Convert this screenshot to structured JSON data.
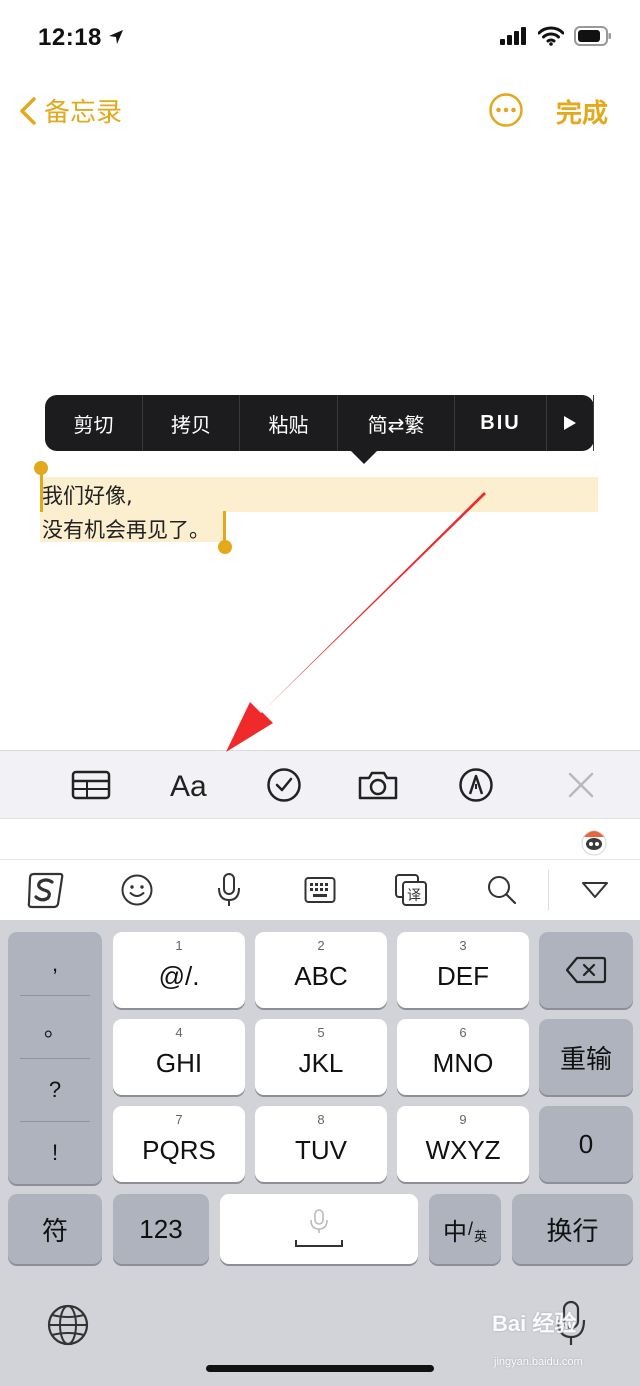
{
  "status_bar": {
    "time": "12:18"
  },
  "nav": {
    "back_label": "备忘录",
    "done_label": "完成"
  },
  "edit_menu": {
    "items": [
      "剪切",
      "拷贝",
      "粘贴",
      "简⇄繁",
      "BIU"
    ]
  },
  "note": {
    "lines": [
      "我们好像,",
      "没有机会再见了。"
    ]
  },
  "keyboard": {
    "punctuation": [
      ",",
      "。",
      "?",
      "!"
    ],
    "keys": [
      {
        "num": "1",
        "label": "@/."
      },
      {
        "num": "2",
        "label": "ABC"
      },
      {
        "num": "3",
        "label": "DEF"
      },
      {
        "num": "4",
        "label": "GHI"
      },
      {
        "num": "5",
        "label": "JKL"
      },
      {
        "num": "6",
        "label": "MNO"
      },
      {
        "num": "7",
        "label": "PQRS"
      },
      {
        "num": "8",
        "label": "TUV"
      },
      {
        "num": "9",
        "label": "WXYZ"
      }
    ],
    "reenter_label": "重输",
    "zero_label": "0",
    "symbol_label": "符",
    "num123_label": "123",
    "lang_main": "中",
    "lang_sub": "英",
    "return_label": "换行"
  },
  "watermark": {
    "text": "Bai 经验",
    "sub": "jingyan.baidu.com"
  },
  "colors": {
    "accent": "#E3A81B",
    "menu_bg": "#1c1c1e",
    "selection": "#FBEFCF",
    "arrow": "#F02A2A"
  }
}
